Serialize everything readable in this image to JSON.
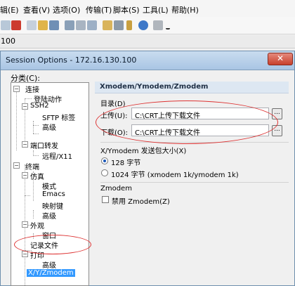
{
  "menubar": {
    "items": [
      "辑(E)",
      "查看(V)",
      "选项(O)",
      "传输(T)",
      "脚本(S)",
      "工具(L)",
      "帮助(H)"
    ]
  },
  "tab": {
    "label": "100"
  },
  "dialog": {
    "title": "Session Options - 172.16.130.100",
    "category_label": "分类(C):",
    "tree": [
      {
        "label": "连接",
        "level": 0,
        "expander": "−"
      },
      {
        "label": "登陆动作",
        "level": 1
      },
      {
        "label": "SSH2",
        "level": 1,
        "expander": "−"
      },
      {
        "label": "SFTP 标签",
        "level": 2
      },
      {
        "label": "高级",
        "level": 2
      },
      {
        "label": "端口转发",
        "level": 1,
        "expander": "−"
      },
      {
        "label": "远程/X11",
        "level": 2
      },
      {
        "label": "终端",
        "level": 0,
        "expander": "−"
      },
      {
        "label": "仿真",
        "level": 1,
        "expander": "−"
      },
      {
        "label": "模式",
        "level": 2
      },
      {
        "label": "Emacs",
        "level": 2
      },
      {
        "label": "映射键",
        "level": 2
      },
      {
        "label": "高级",
        "level": 2
      },
      {
        "label": "外观",
        "level": 1,
        "expander": "−"
      },
      {
        "label": "窗口",
        "level": 2
      },
      {
        "label": "记录文件",
        "level": 1
      },
      {
        "label": "打印",
        "level": 1,
        "expander": "−"
      },
      {
        "label": "高级",
        "level": 2
      },
      {
        "label": "X/Y/Zmodem",
        "level": 1,
        "selected": true
      }
    ],
    "panel": {
      "header": "Xmodem/Ymodem/Zmodem",
      "dir_label": "目录(D)",
      "upload_label": "上传(U):",
      "upload_value": "C:\\CRT上传下载文件",
      "download_label": "下载(O):",
      "download_value": "C:\\CRT上传下载文件",
      "browse": "...",
      "packet_label": "X/Ymodem 发送包大小(X)",
      "opt_128": "128 字节",
      "opt_1024": "1024 字节  (xmodem 1k/ymodem 1k)",
      "zmodem_label": "Zmodem",
      "disable_zmodem": "禁用 Zmodem(Z)"
    }
  },
  "colors": {
    "annotation": "#dd3333",
    "selection": "#3399ff"
  }
}
